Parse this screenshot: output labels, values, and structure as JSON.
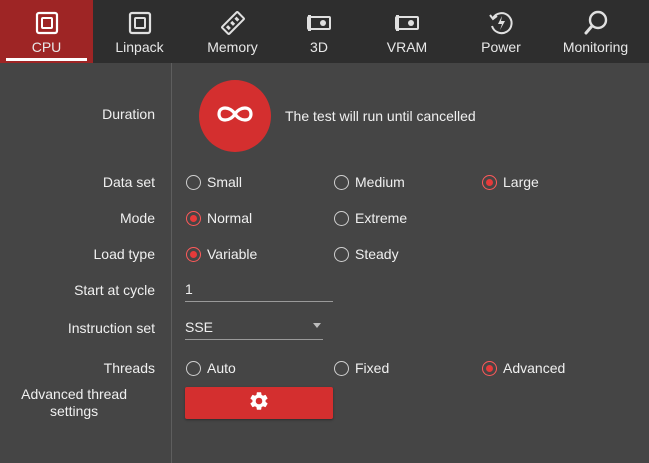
{
  "tabs": [
    {
      "label": "CPU",
      "icon": "cpu-icon",
      "active": true
    },
    {
      "label": "Linpack",
      "icon": "linpack-icon",
      "active": false
    },
    {
      "label": "Memory",
      "icon": "memory-icon",
      "active": false
    },
    {
      "label": "3D",
      "icon": "gpu-3d-icon",
      "active": false
    },
    {
      "label": "VRAM",
      "icon": "vram-icon",
      "active": false
    },
    {
      "label": "Power",
      "icon": "power-icon",
      "active": false
    },
    {
      "label": "Monitoring",
      "icon": "monitoring-icon",
      "active": false
    }
  ],
  "colors": {
    "accent": "#d42f2f",
    "active_tab": "#9e2525",
    "tabbar_bg": "#2e2e2e",
    "panel_bg": "#454545"
  },
  "duration": {
    "label": "Duration",
    "icon": "infinity-icon",
    "text": "The test will run until cancelled"
  },
  "data_set": {
    "label": "Data set",
    "options": [
      "Small",
      "Medium",
      "Large"
    ],
    "selected": "Large"
  },
  "mode": {
    "label": "Mode",
    "options": [
      "Normal",
      "Extreme"
    ],
    "selected": "Normal"
  },
  "load_type": {
    "label": "Load type",
    "options": [
      "Variable",
      "Steady"
    ],
    "selected": "Variable"
  },
  "start_at_cycle": {
    "label": "Start at cycle",
    "value": "1"
  },
  "instruction_set": {
    "label": "Instruction set",
    "value": "SSE"
  },
  "threads": {
    "label": "Threads",
    "options": [
      "Auto",
      "Fixed",
      "Advanced"
    ],
    "selected": "Advanced"
  },
  "advanced_thread_settings": {
    "label_line1": "Advanced thread",
    "label_line2": "settings",
    "icon": "gear-icon"
  }
}
